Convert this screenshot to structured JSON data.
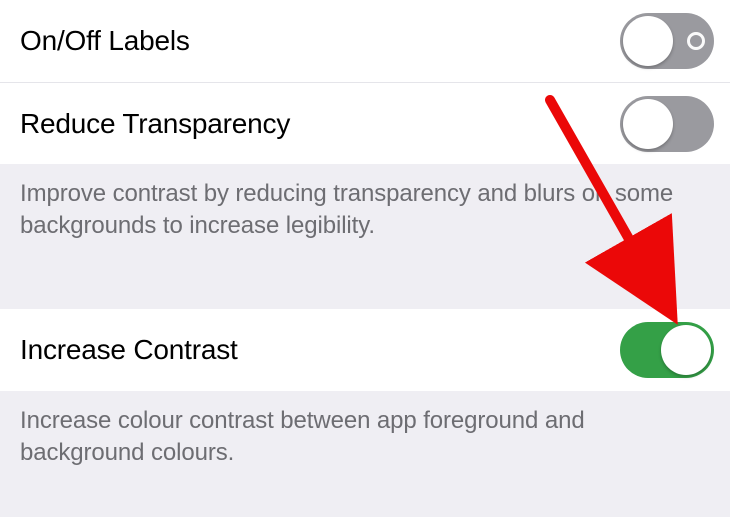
{
  "settings": [
    {
      "label": "On/Off Labels",
      "on": false,
      "show_onoff_ring": true,
      "footer": null
    },
    {
      "label": "Reduce Transparency",
      "on": false,
      "show_onoff_ring": false,
      "footer": "Improve contrast by reducing transparency and blurs on some backgrounds to increase legibility."
    },
    {
      "label": "Increase Contrast",
      "on": true,
      "show_onoff_ring": false,
      "footer": "Increase colour contrast between app foreground and background colours."
    }
  ],
  "colors": {
    "toggle_on": "#34a047",
    "toggle_off": "#9a9a9f",
    "annotation_arrow": "#eb0808"
  }
}
